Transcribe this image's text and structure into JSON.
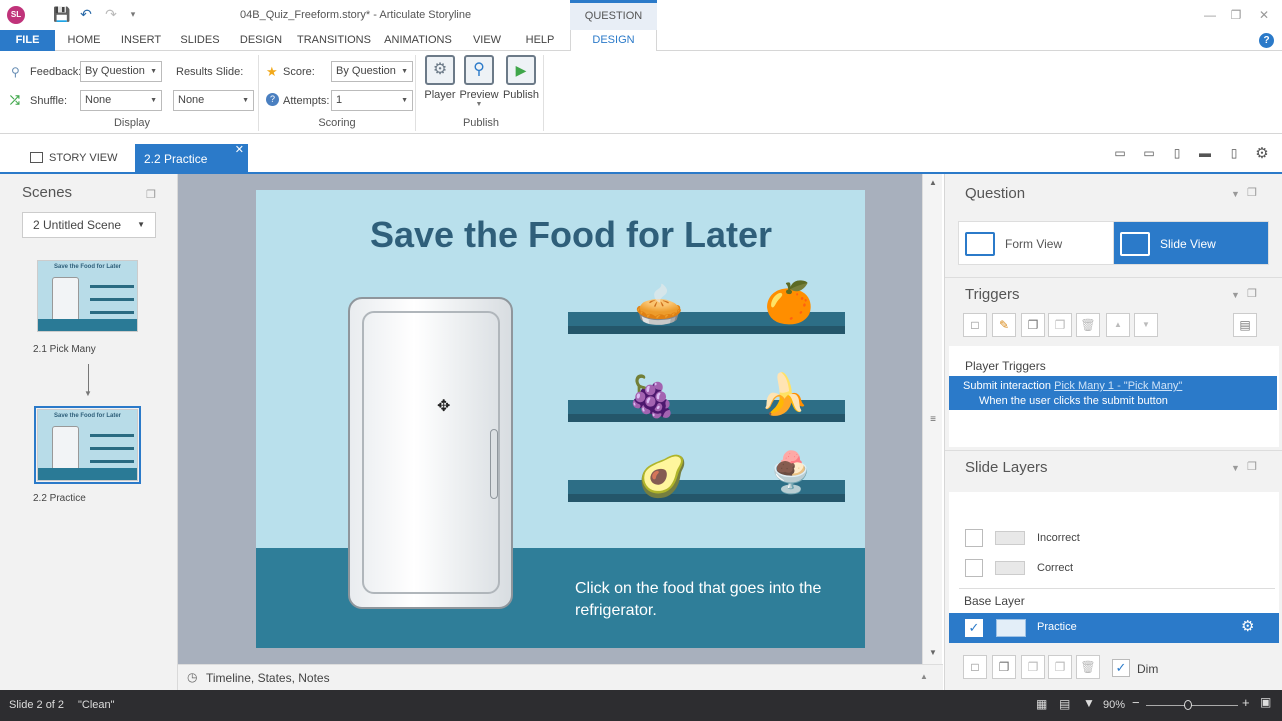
{
  "window": {
    "title": "04B_Quiz_Freeform.story* - Articulate Storyline",
    "logo": "SL",
    "contextual_tab_group": "QUESTION TOOLS"
  },
  "ribbon_tabs": [
    "FILE",
    "HOME",
    "INSERT",
    "SLIDES",
    "DESIGN",
    "TRANSITIONS",
    "ANIMATIONS",
    "VIEW",
    "HELP",
    "DESIGN"
  ],
  "ribbon": {
    "display": {
      "feedback_label": "Feedback:",
      "feedback_value": "By Question",
      "shuffle_label": "Shuffle:",
      "shuffle_value": "None",
      "results_slide_label": "Results Slide:",
      "results_slide_value": "None",
      "group_label": "Display"
    },
    "scoring": {
      "score_label": "Score:",
      "score_value": "By Question",
      "attempts_label": "Attempts:",
      "attempts_value": "1",
      "group_label": "Scoring"
    },
    "publish": {
      "player_label": "Player",
      "preview_label": "Preview",
      "publish_label": "Publish",
      "group_label": "Publish"
    }
  },
  "doc_tabs": {
    "story_view": "STORY VIEW",
    "active_tab": "2.2 Practice"
  },
  "scenes": {
    "title": "Scenes",
    "selected_scene": "2 Untitled Scene",
    "slides": [
      {
        "label": "2.1 Pick Many",
        "thumb_title": "Save the Food for Later"
      },
      {
        "label": "2.2 Practice",
        "thumb_title": "Save the Food for Later"
      }
    ]
  },
  "slide": {
    "title": "Save the Food for Later",
    "instruction": "Click on the food that goes into the refrigerator."
  },
  "timeline_bar": "Timeline, States, Notes",
  "question_panel": {
    "title": "Question",
    "form_view": "Form View",
    "slide_view": "Slide View"
  },
  "triggers_panel": {
    "title": "Triggers",
    "section": "Player Triggers",
    "trigger_action": "Submit interaction",
    "trigger_link": "Pick Many 1 - \"Pick Many\"",
    "trigger_condition": "When the user clicks the submit button"
  },
  "layers_panel": {
    "title": "Slide Layers",
    "layers": [
      "Incorrect",
      "Correct"
    ],
    "base_label": "Base Layer",
    "base_layer": "Practice",
    "dim_label": "Dim"
  },
  "status": {
    "slide": "Slide 2 of 2",
    "theme": "\"Clean\"",
    "zoom": "90%"
  },
  "colors": {
    "accent": "#2b7ac9",
    "slide_bg": "#b9e0ec",
    "title_text": "#2f5f7a",
    "floor": "#2f7e99",
    "status_bar": "#2d2d30"
  }
}
